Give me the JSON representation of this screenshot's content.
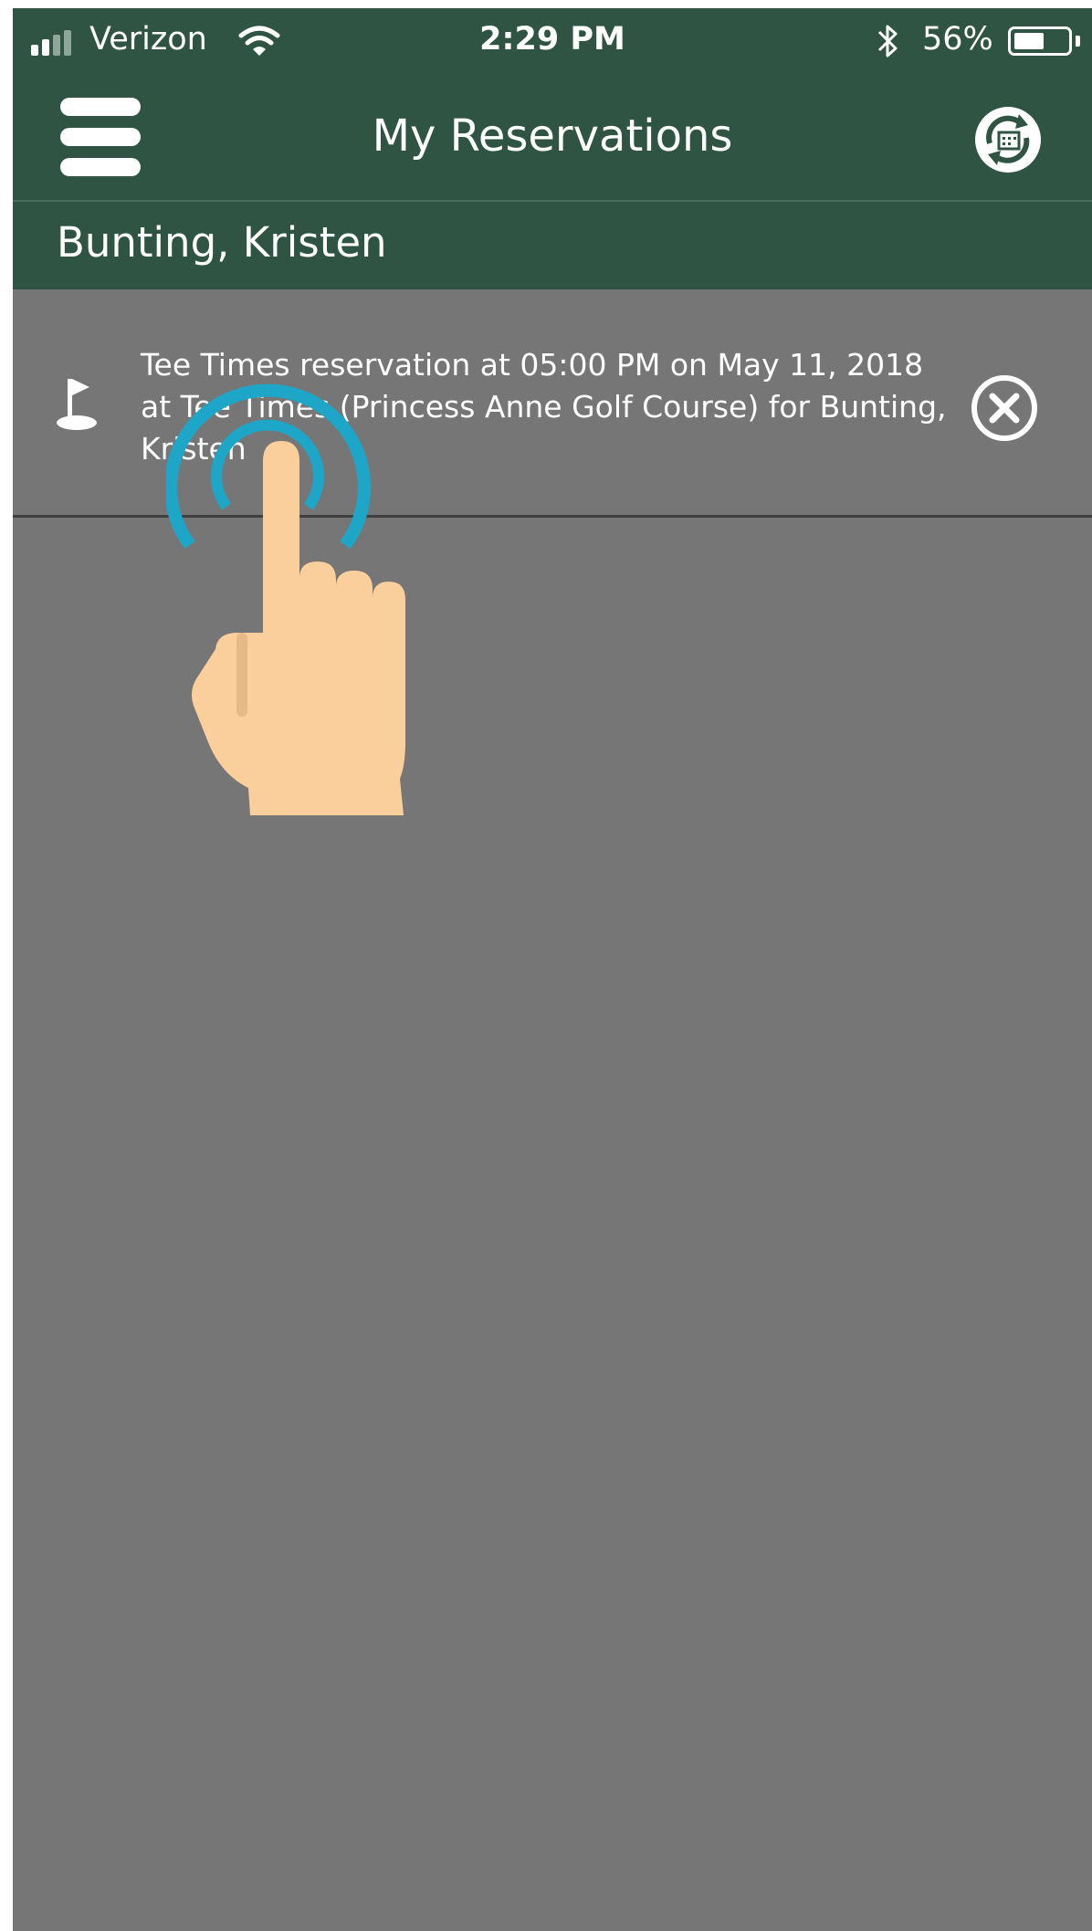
{
  "status_bar": {
    "carrier": "Verizon",
    "time": "2:29 PM",
    "battery_percent": "56%",
    "battery_level": 0.56,
    "icons": [
      "signal-icon",
      "wifi-icon",
      "bluetooth-icon",
      "battery-icon"
    ]
  },
  "header": {
    "title": "My Reservations",
    "menu_icon": "hamburger-menu-icon",
    "refresh_icon": "refresh-calendar-icon"
  },
  "member": {
    "name": "Bunting, Kristen"
  },
  "reservations": [
    {
      "icon": "golf-flag-icon",
      "text": "Tee Times reservation at 05:00 PM on May 11, 2018 at Tee Times (Princess Anne Golf Course) for Bunting, Kristen",
      "action_icon": "cancel-circle-icon"
    }
  ],
  "colors": {
    "header_bg": "#2f5444",
    "content_bg": "#767676",
    "text": "#ffffff",
    "tap_ring": "#1ea6c9",
    "hand": "#fbcf9c"
  }
}
